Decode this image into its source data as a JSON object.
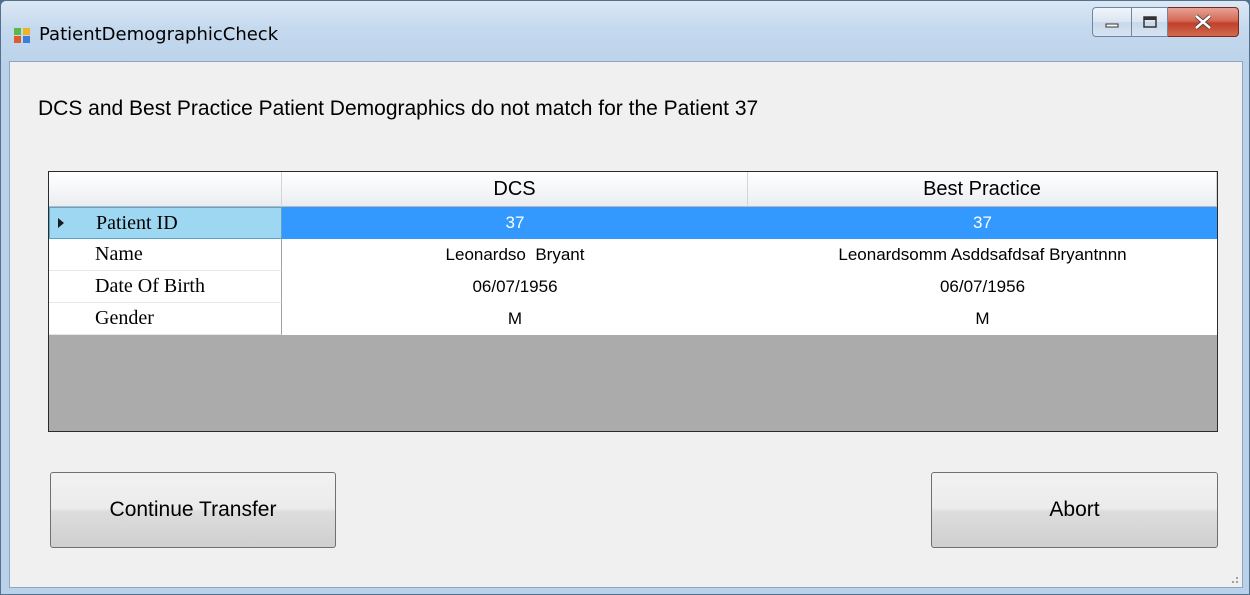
{
  "window": {
    "title": "PatientDemographicCheck",
    "accent_colors": {
      "titlebar": "#c5d9ee",
      "close": "#c0412b",
      "selection": "#3399ff"
    }
  },
  "message": "DCS and Best Practice Patient Demographics do not match for the Patient 37",
  "grid": {
    "columns": [
      "DCS",
      "Best Practice"
    ],
    "rows": [
      {
        "label": "Patient ID",
        "dcs": "37",
        "best_practice": "37",
        "selected": true
      },
      {
        "label": "Name",
        "dcs": "Leonardso  Bryant",
        "best_practice": "Leonardsomm Asddsafdsaf Bryantnnn"
      },
      {
        "label": "Date Of Birth",
        "dcs": "06/07/1956",
        "best_practice": "06/07/1956"
      },
      {
        "label": "Gender",
        "dcs": "M",
        "best_practice": "M"
      }
    ]
  },
  "buttons": {
    "continue": "Continue Transfer",
    "abort": "Abort"
  },
  "icons": [
    "app-icon",
    "minimize-icon",
    "maximize-icon",
    "close-icon",
    "row-pointer-icon",
    "resize-grip-icon"
  ]
}
